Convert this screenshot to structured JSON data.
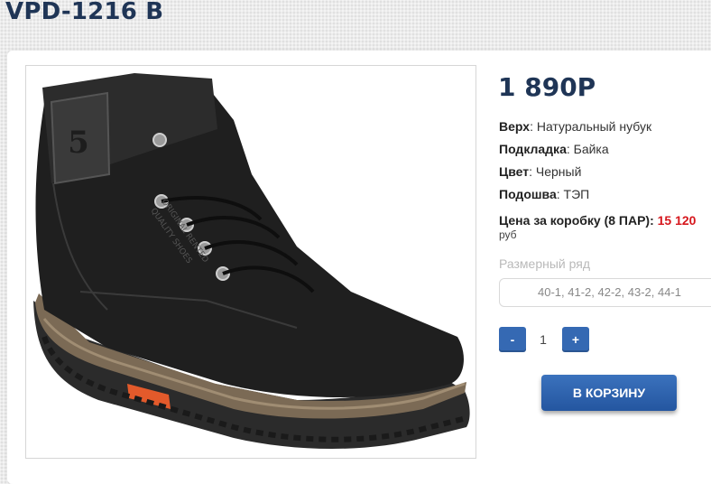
{
  "product": {
    "title": "VPD-1216 B",
    "price": "1 890Р",
    "specs": [
      {
        "label": "Верх",
        "value": ": Натуральный нубук"
      },
      {
        "label": "Подкладка",
        "value": ": Байка"
      },
      {
        "label": "Цвет",
        "value": ": Черный"
      },
      {
        "label": "Подошва",
        "value": ": ТЭП"
      }
    ],
    "box_price": {
      "label": "Цена за коробку (8 ПАР):",
      "value": "15 120",
      "unit": "руб"
    },
    "sizes": {
      "label": "Размерный ряд",
      "value": "40-1, 41-2, 42-2, 43-2, 44-1"
    }
  },
  "quantity": {
    "minus_label": "-",
    "value": "1",
    "plus_label": "+"
  },
  "cart_button_label": "В КОРЗИНУ",
  "image": {
    "description_icon": "boot-photo",
    "tongue_text": "5",
    "side_print_lines": [
      "ORIGINAL RENTED",
      "QUALITY SHOES"
    ]
  },
  "colors": {
    "accent": "#3569b3",
    "title": "#1f3556",
    "highlight": "#d6161c"
  }
}
